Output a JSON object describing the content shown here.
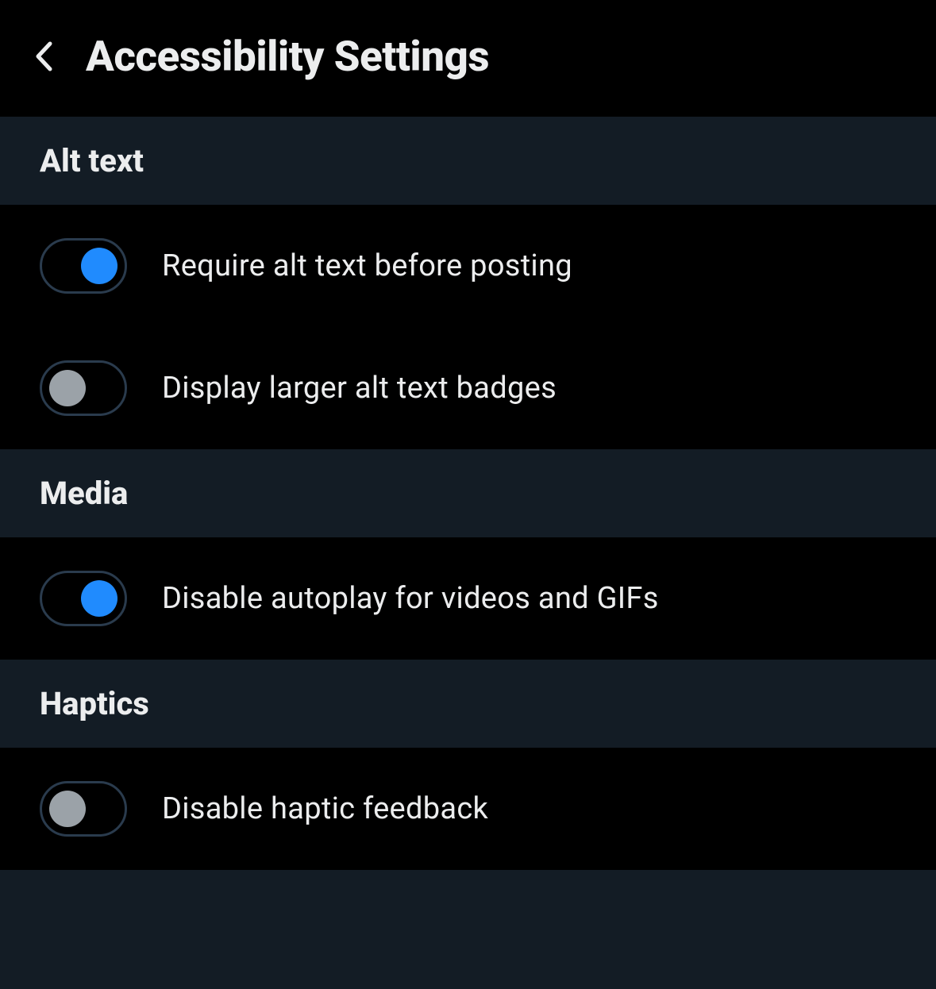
{
  "header": {
    "title": "Accessibility Settings"
  },
  "sections": [
    {
      "title": "Alt text",
      "items": [
        {
          "label": "Require alt text before posting",
          "on": true
        },
        {
          "label": "Display larger alt text badges",
          "on": false
        }
      ]
    },
    {
      "title": "Media",
      "items": [
        {
          "label": "Disable autoplay for videos and GIFs",
          "on": true
        }
      ]
    },
    {
      "title": "Haptics",
      "items": [
        {
          "label": "Disable haptic feedback",
          "on": false
        }
      ]
    }
  ],
  "colors": {
    "bg": "#000000",
    "sectionBg": "#131C25",
    "text": "#ECEDEE",
    "toggleOn": "#208BFE",
    "toggleOff": "#9BA2A8",
    "toggleBorder": "#2A3B4D"
  }
}
